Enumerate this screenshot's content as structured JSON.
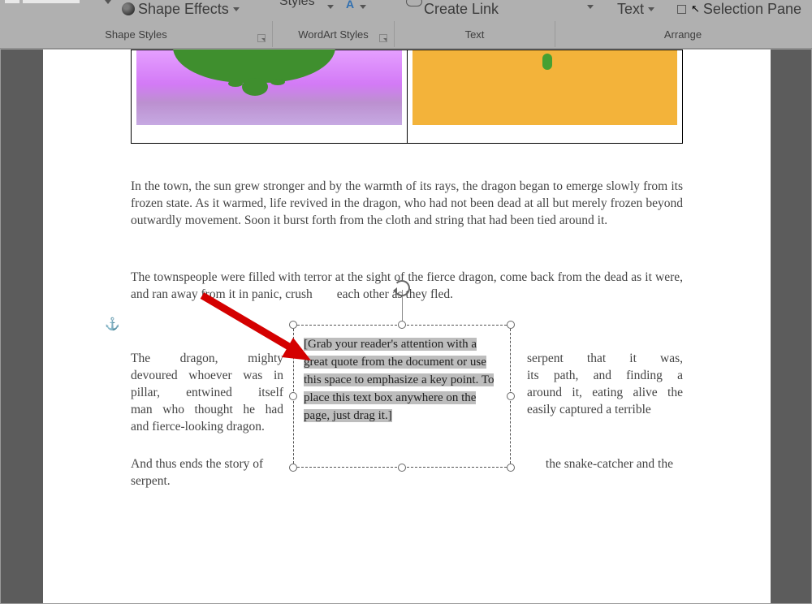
{
  "ribbon": {
    "top": {
      "shape_effects": "Shape Effects",
      "styles": "Styles",
      "create_link": "Create Link",
      "text": "Text",
      "selection_pane": "Selection Pane"
    },
    "groups": {
      "shape_styles": "Shape Styles",
      "wordart_styles": "WordArt Styles",
      "text": "Text",
      "arrange": "Arrange"
    }
  },
  "document": {
    "anchor_glyph": "⚓",
    "para1": "In the town, the sun grew stronger and by the warmth of its rays, the dragon began to emerge slowly from its frozen state. As it warmed, life revived in the dragon, who had not been dead at all but merely frozen beyond outwardly movement. Soon it burst forth from the cloth and string that had been tied around it.",
    "para2_a": "The townspeople were filled with terror at the sight of the fierce dragon, come back from the dead as it were, and ran away from it in panic, crush",
    "para2_b": " each other as they fled.",
    "para3": {
      "left": {
        "l1": "The dragon, mighty",
        "l2": "devoured whoever was in",
        "l3": "pillar, entwined itself",
        "l4": "man who thought he had",
        "l5": "and fierce-looking dragon."
      },
      "right": {
        "r1": "serpent that it was,",
        "r2": "its path, and finding a",
        "r3": "around it, eating alive the",
        "r4": "easily captured a terrible"
      }
    },
    "para4": {
      "seg_left": "And thus ends the story of",
      "seg_right": "the snake-catcher and the",
      "below": "serpent."
    },
    "textbox": "[Grab your reader's attention with a great quote from the document or use this space to emphasize a key point. To place this text box anywhere on the page, just drag it.]"
  }
}
